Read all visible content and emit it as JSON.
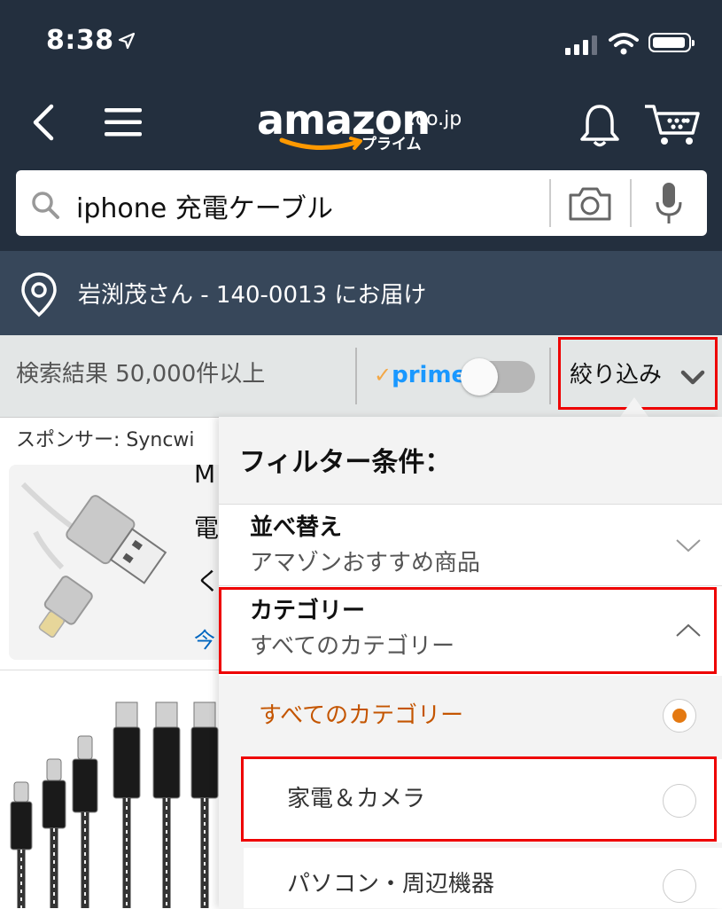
{
  "status_bar": {
    "time": "8:38"
  },
  "header": {
    "logo_main": "amazon",
    "logo_tld": ".co.jp",
    "logo_sub": "プライム"
  },
  "search": {
    "query": "iphone 充電ケーブル"
  },
  "address": {
    "text": "岩渕茂さん - 140-0013 にお届け"
  },
  "results_bar": {
    "count": "検索結果 50,000件以上",
    "prime_label": "prime",
    "prime_toggle_on": false,
    "filter_label": "絞り込み"
  },
  "product_list": {
    "sponsor": "スポンサー: Syncwi",
    "title_chars": [
      "M",
      "電",
      "く"
    ],
    "link_char": "今"
  },
  "filter_panel": {
    "title": "フィルター条件：",
    "sort": {
      "label": "並べ替え",
      "value": "アマゾンおすすめ商品"
    },
    "category": {
      "label": "カテゴリー",
      "value": "すべてのカテゴリー"
    },
    "options": [
      {
        "label": "すべてのカテゴリー",
        "selected": true
      },
      {
        "label": "家電＆カメラ",
        "selected": false
      },
      {
        "label": "パソコン・周辺機器",
        "selected": false
      }
    ]
  },
  "colors": {
    "header_bg": "#232f3e",
    "address_bg": "#37475a",
    "accent_orange": "#e47911",
    "selected_text": "#c45500",
    "highlight_red": "#ee0000",
    "prime_blue": "#1a98ff"
  }
}
